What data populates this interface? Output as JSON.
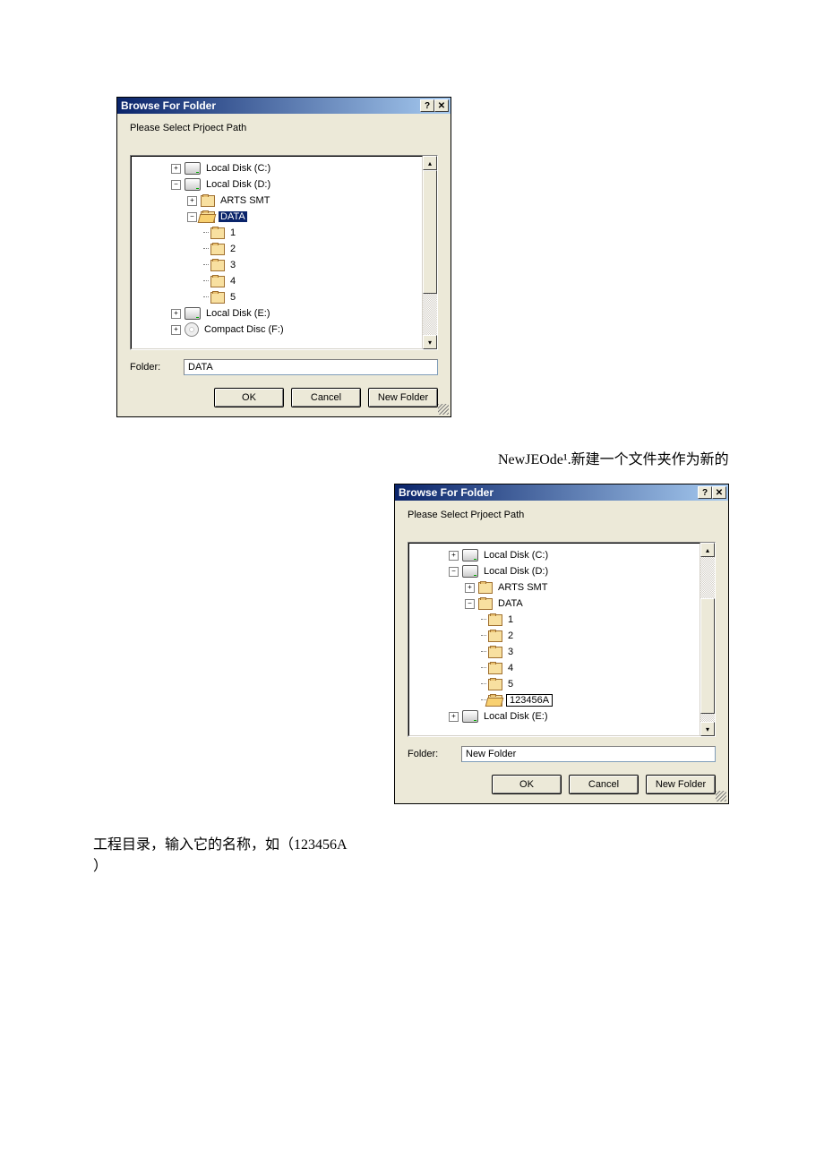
{
  "text": {
    "caption1": "NewJEOde¹.新建一个文件夹作为新的",
    "caption2_line1": "工程目录，输入它的名称，如（123456A",
    "caption2_line2": "）"
  },
  "dialog1": {
    "title": "Browse For Folder",
    "prompt": "Please Select Prjoect Path",
    "tree": {
      "c": "Local Disk (C:)",
      "d": "Local Disk (D:)",
      "arts": "ARTS SMT",
      "data": "DATA",
      "f1": "1",
      "f2": "2",
      "f3": "3",
      "f4": "4",
      "f5": "5",
      "e": "Local Disk (E:)",
      "cd": "Compact Disc (F:)"
    },
    "folder_label": "Folder:",
    "folder_value": "DATA",
    "buttons": {
      "ok": "OK",
      "cancel": "Cancel",
      "new": "New Folder"
    },
    "titlebar_help": "?",
    "titlebar_close": "✕"
  },
  "dialog2": {
    "title": "Browse For Folder",
    "prompt": "Please Select Prjoect Path",
    "tree": {
      "c": "Local Disk (C:)",
      "d": "Local Disk (D:)",
      "arts": "ARTS SMT",
      "data": "DATA",
      "f1": "1",
      "f2": "2",
      "f3": "3",
      "f4": "4",
      "f5": "5",
      "newfolder": "123456A",
      "e": "Local Disk (E:)"
    },
    "folder_label": "Folder:",
    "folder_value": "New Folder",
    "buttons": {
      "ok": "OK",
      "cancel": "Cancel",
      "new": "New Folder"
    },
    "titlebar_help": "?",
    "titlebar_close": "✕"
  }
}
